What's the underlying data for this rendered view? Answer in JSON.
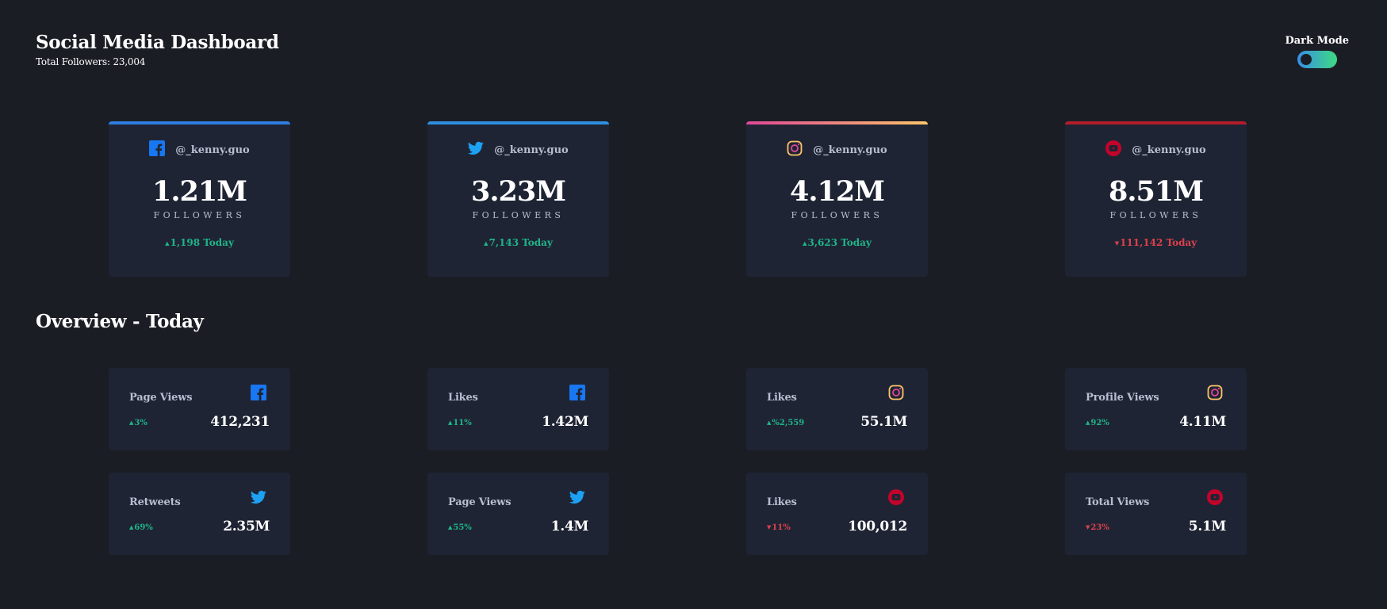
{
  "header": {
    "title": "Social Media Dashboard",
    "total_followers": "Total Followers: 23,004"
  },
  "mode": {
    "label": "Dark Mode",
    "enabled": true
  },
  "colors": {
    "facebook": "#1877f2",
    "twitter": "#1da1f2",
    "instagram_start": "#df4896",
    "instagram_end": "#fdc468",
    "youtube": "#c4032b",
    "up": "#1eb589",
    "down": "#dc414c"
  },
  "cards": [
    {
      "platform": "facebook",
      "icon": "facebook-icon",
      "handle": "@_kenny.guo",
      "count": "1.21M",
      "caption": "FOLLOWERS",
      "today": "1,198 Today",
      "trend": "up"
    },
    {
      "platform": "twitter",
      "icon": "twitter-icon",
      "handle": "@_kenny.guo",
      "count": "3.23M",
      "caption": "FOLLOWERS",
      "today": "7,143 Today",
      "trend": "up"
    },
    {
      "platform": "instagram",
      "icon": "instagram-icon",
      "handle": "@_kenny.guo",
      "count": "4.12M",
      "caption": "FOLLOWERS",
      "today": "3,623 Today",
      "trend": "up"
    },
    {
      "platform": "youtube",
      "icon": "youtube-icon",
      "handle": "@_kenny.guo",
      "count": "8.51M",
      "caption": "FOLLOWERS",
      "today": "111,142 Today",
      "trend": "down"
    }
  ],
  "overview": {
    "title": "Overview - Today",
    "tiles": [
      {
        "label": "Page Views",
        "platform": "facebook",
        "icon": "facebook-icon",
        "pct": "3%",
        "value": "412,231",
        "trend": "up"
      },
      {
        "label": "Likes",
        "platform": "facebook",
        "icon": "facebook-icon",
        "pct": "11%",
        "value": "1.42M",
        "trend": "up"
      },
      {
        "label": "Likes",
        "platform": "instagram",
        "icon": "instagram-icon",
        "pct": "%2,559",
        "value": "55.1M",
        "trend": "up"
      },
      {
        "label": "Profile Views",
        "platform": "instagram",
        "icon": "instagram-icon",
        "pct": "92%",
        "value": "4.11M",
        "trend": "up"
      },
      {
        "label": "Retweets",
        "platform": "twitter",
        "icon": "twitter-icon",
        "pct": "69%",
        "value": "2.35M",
        "trend": "up"
      },
      {
        "label": "Page Views",
        "platform": "twitter",
        "icon": "twitter-icon",
        "pct": "55%",
        "value": "1.4M",
        "trend": "up"
      },
      {
        "label": "Likes",
        "platform": "youtube",
        "icon": "youtube-icon",
        "pct": "11%",
        "value": "100,012",
        "trend": "down"
      },
      {
        "label": "Total Views",
        "platform": "youtube",
        "icon": "youtube-icon",
        "pct": "23%",
        "value": "5.1M",
        "trend": "down"
      }
    ]
  }
}
